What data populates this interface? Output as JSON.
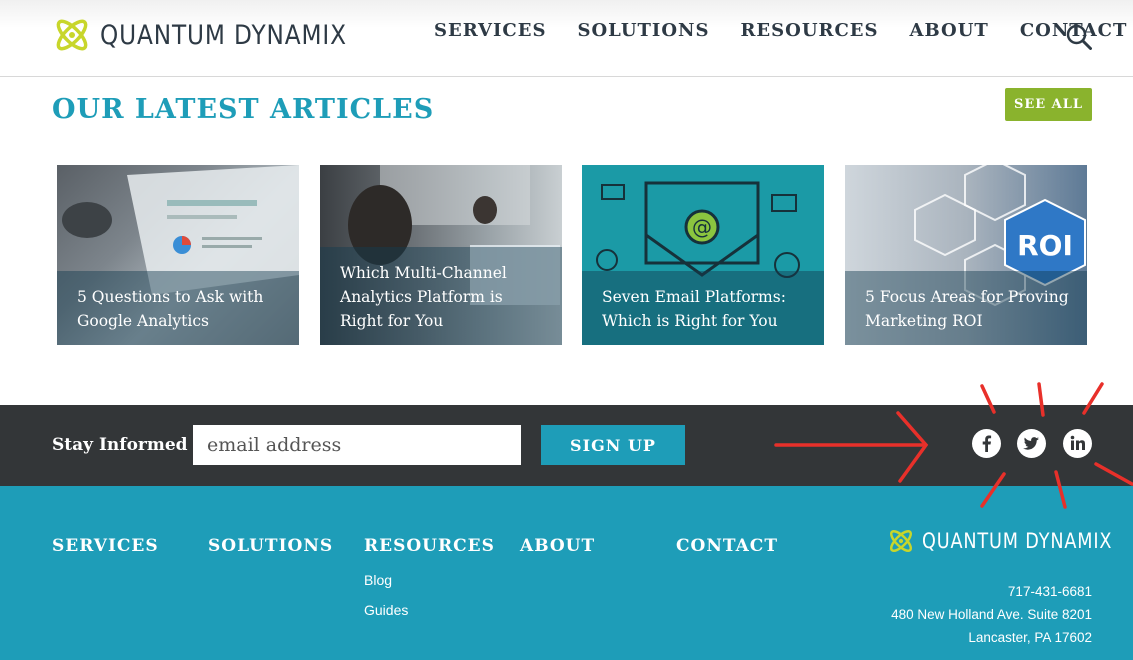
{
  "header": {
    "brand": "QUANTUM DYNAMIX",
    "nav": [
      "SERVICES",
      "SOLUTIONS",
      "RESOURCES",
      "ABOUT",
      "CONTACT"
    ],
    "search_icon": "search-icon"
  },
  "articles": {
    "title": "OUR LATEST ARTICLES",
    "see_all": "SEE ALL",
    "cards": [
      {
        "title": "5 Questions to Ask with Google Analytics"
      },
      {
        "title": "Which Multi-Channel Analytics Platform is Right for You"
      },
      {
        "title": "Seven Email Platforms: Which is Right for You"
      },
      {
        "title": "5 Focus Areas for Proving Marketing ROI"
      }
    ]
  },
  "newsletter": {
    "label": "Stay Informed",
    "placeholder": "email address",
    "button": "SIGN UP",
    "social": [
      "facebook-icon",
      "twitter-icon",
      "linkedin-icon"
    ]
  },
  "footer": {
    "columns": [
      {
        "heading": "SERVICES",
        "links": []
      },
      {
        "heading": "SOLUTIONS",
        "links": []
      },
      {
        "heading": "RESOURCES",
        "links": [
          "Blog",
          "Guides"
        ]
      },
      {
        "heading": "ABOUT",
        "links": []
      },
      {
        "heading": "CONTACT",
        "links": []
      }
    ],
    "brand": "QUANTUM DYNAMIX",
    "phone": "717-431-6681",
    "address1": "480 New Holland Ave. Suite 8201",
    "address2": "Lancaster, PA 17602"
  },
  "colors": {
    "accent": "#1e9db8",
    "green": "#8ab32d",
    "dark": "#333638",
    "annotation": "#e8302a"
  }
}
